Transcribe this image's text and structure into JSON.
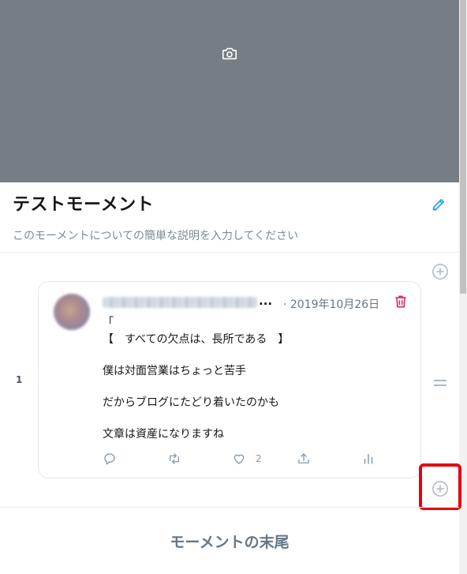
{
  "moment": {
    "title": "テストモーメント",
    "description_placeholder": "このモーメントについての簡単な説明を入力してください",
    "end_label": "モーメントの末尾"
  },
  "tweet": {
    "index": "1",
    "author_name_blurred": true,
    "author_ellipsis": "...",
    "date": "· 2019年10月26日",
    "lines": [
      "「",
      "【　すべての欠点は、長所である　】",
      "僕は対面営業はちょっと苦手",
      "だからブログにたどり着いたのかも",
      "文章は資産になりますね"
    ],
    "like_count": "2"
  },
  "icons": {
    "cover": "camera-icon",
    "edit": "pencil-icon",
    "add": "add-circle-icon",
    "reorder": "reorder-icon",
    "delete": "trash-icon",
    "actions": [
      "reply-icon",
      "retweet-icon",
      "like-icon",
      "share-icon",
      "analytics-icon"
    ]
  },
  "colors": {
    "cover": "#747e84",
    "accent": "#1da1f2",
    "delete": "#e0245e",
    "highlight": "#e60012",
    "muted": "#657786"
  }
}
